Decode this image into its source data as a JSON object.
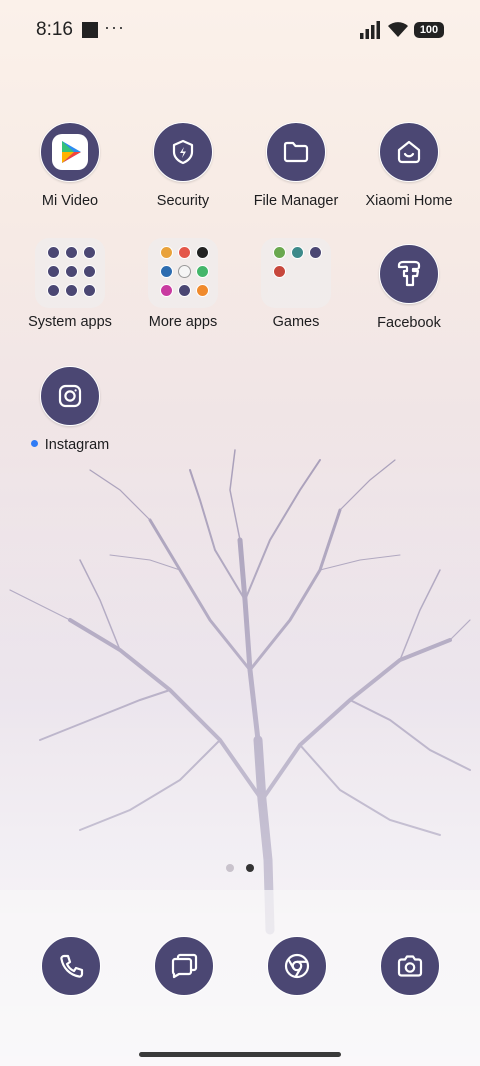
{
  "status_bar": {
    "time": "8:16",
    "overflow": "···",
    "battery": "100"
  },
  "apps": [
    {
      "label": "Mi Video",
      "icon": "mi-video-icon"
    },
    {
      "label": "Security",
      "icon": "shield-bolt-icon"
    },
    {
      "label": "File Manager",
      "icon": "folder-icon"
    },
    {
      "label": "Xiaomi Home",
      "icon": "xiaomi-home-icon"
    },
    {
      "label": "System apps",
      "icon": "folder-system-apps-icon"
    },
    {
      "label": "More apps",
      "icon": "folder-more-apps-icon"
    },
    {
      "label": "Games",
      "icon": "folder-games-icon"
    },
    {
      "label": "Facebook",
      "icon": "facebook-icon"
    },
    {
      "label": "Instagram",
      "icon": "instagram-icon",
      "new_dot": true
    }
  ],
  "page_indicator": {
    "pages": 2,
    "current": 2
  },
  "dock": [
    {
      "icon": "phone-icon"
    },
    {
      "icon": "messages-icon"
    },
    {
      "icon": "chrome-icon"
    },
    {
      "icon": "camera-icon"
    }
  ],
  "colors": {
    "icon_bg": "#4b4773",
    "new_dot": "#2f7bf5"
  }
}
